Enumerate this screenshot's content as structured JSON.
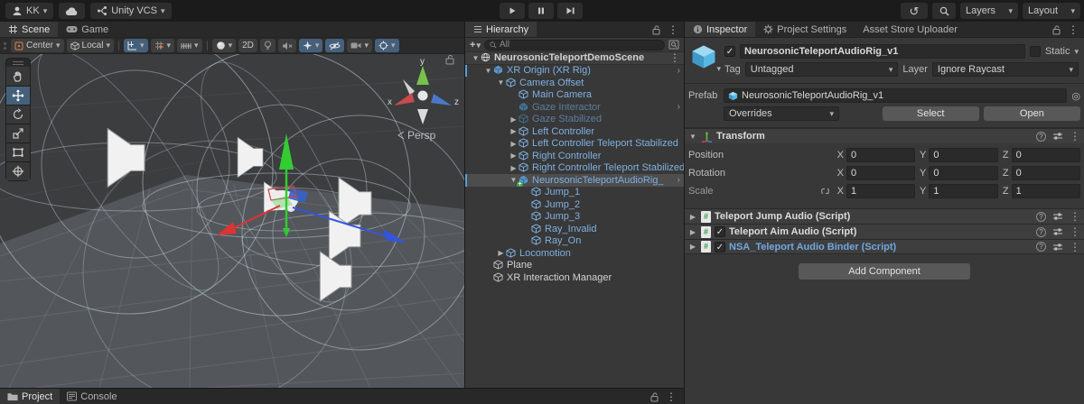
{
  "topbar": {
    "account": "KK",
    "vcs": "Unity VCS",
    "layers": "Layers",
    "layout": "Layout"
  },
  "scene": {
    "tabs": {
      "scene": "Scene",
      "game": "Game"
    },
    "toolbar": {
      "center": "Center",
      "local": "Local",
      "two_d": "2D"
    },
    "viewport": {
      "persp": "Persp",
      "axis_x": "x",
      "axis_y": "y",
      "axis_z": "z"
    }
  },
  "hierarchy": {
    "title": "Hierarchy",
    "create": "+",
    "search_placeholder": "All",
    "rows": [
      {
        "label": "NeurosonicTeleportDemoScene",
        "arrow": "▼",
        "right": ""
      },
      {
        "label": "XR Origin (XR Rig)",
        "arrow": "▼",
        "right": "›"
      },
      {
        "label": "Camera Offset",
        "arrow": "▼",
        "right": ""
      },
      {
        "label": "Main Camera",
        "arrow": "",
        "right": ""
      },
      {
        "label": "Gaze Interactor",
        "arrow": "",
        "right": "›"
      },
      {
        "label": "Gaze Stabilized",
        "arrow": "▶",
        "right": ""
      },
      {
        "label": "Left Controller",
        "arrow": "▶",
        "right": ""
      },
      {
        "label": "Left Controller Teleport Stabilized",
        "arrow": "▶",
        "right": ""
      },
      {
        "label": "Right Controller",
        "arrow": "▶",
        "right": ""
      },
      {
        "label": "Right Controller Teleport Stabilized",
        "arrow": "▶",
        "right": ""
      },
      {
        "label": "NeurosonicTeleportAudioRig_",
        "arrow": "▼",
        "right": "›"
      },
      {
        "label": "Jump_1",
        "arrow": "",
        "right": ""
      },
      {
        "label": "Jump_2",
        "arrow": "",
        "right": ""
      },
      {
        "label": "Jump_3",
        "arrow": "",
        "right": ""
      },
      {
        "label": "Ray_Invalid",
        "arrow": "",
        "right": ""
      },
      {
        "label": "Ray_On",
        "arrow": "",
        "right": ""
      },
      {
        "label": "Locomotion",
        "arrow": "▶",
        "right": ""
      },
      {
        "label": "Plane",
        "arrow": "",
        "right": ""
      },
      {
        "label": "XR Interaction Manager",
        "arrow": "",
        "right": ""
      }
    ]
  },
  "inspector": {
    "tabs": [
      "Inspector",
      "Project Settings",
      "Asset Store Uploader"
    ],
    "header": {
      "name": "NeurosonicTeleportAudioRig_v1",
      "static_label": "Static",
      "tag_label": "Tag",
      "tag_value": "Untagged",
      "layer_label": "Layer",
      "layer_value": "Ignore Raycast"
    },
    "prefab": {
      "label": "Prefab",
      "value": "NeurosonicTeleportAudioRig_v1",
      "overrides": "Overrides",
      "select": "Select",
      "open": "Open"
    },
    "transform": {
      "foldout": "▼",
      "title": "Transform",
      "axis_x": "X",
      "axis_y": "Y",
      "axis_z": "Z",
      "rows": [
        {
          "label": "Position",
          "x": "0",
          "y": "0",
          "z": "0"
        },
        {
          "label": "Rotation",
          "x": "0",
          "y": "0",
          "z": "0"
        },
        {
          "label": "Scale",
          "x": "1",
          "y": "1",
          "z": "1"
        }
      ]
    },
    "components": [
      {
        "foldout": "▶",
        "title": "Teleport Jump Audio (Script)"
      },
      {
        "foldout": "▶",
        "title": "Teleport Aim Audio (Script)"
      },
      {
        "foldout": "▶",
        "title": "NSA_Teleport Audio Binder (Script)"
      }
    ],
    "add_component": "Add Component"
  },
  "bottom": {
    "project": "Project",
    "console": "Console"
  },
  "colors": {
    "accent_toggle": "#46607c",
    "prefab_blue": "#7fb0e1",
    "selection_gray": "#4d4d4d",
    "script_title_blue": "#72a7e0"
  }
}
